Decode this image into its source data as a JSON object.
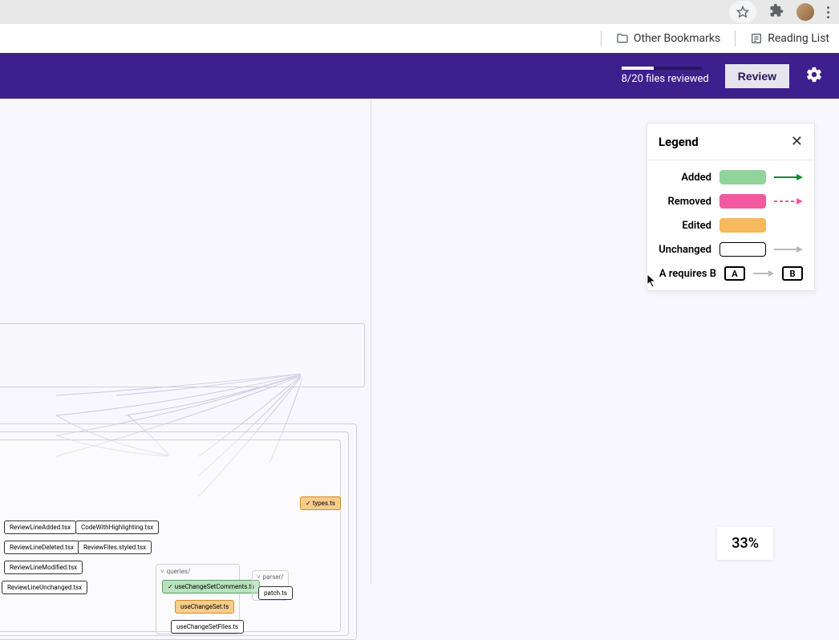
{
  "browser": {
    "otherBookmarks": "Other Bookmarks",
    "readingList": "Reading List"
  },
  "header": {
    "progress": {
      "current": 8,
      "total": 20,
      "label": "8/20 files reviewed",
      "percent": 40
    },
    "reviewButton": "Review"
  },
  "legend": {
    "title": "Legend",
    "rows": {
      "added": "Added",
      "removed": "Removed",
      "edited": "Edited",
      "unchanged": "Unchanged",
      "requires": "A requires B",
      "a": "A",
      "b": "B"
    },
    "colors": {
      "added": "#91d49b",
      "removed": "#f15a9e",
      "edited": "#f6b95c",
      "unchanged": "#ffffff",
      "arrow_added": "#0e8a33",
      "arrow_removed": "#f15a9e",
      "arrow_unchanged": "#b9b9c0"
    }
  },
  "graph": {
    "folders": {
      "queries": "queries/",
      "parser": "parser/"
    },
    "nodes": {
      "types": "types.ts",
      "reviewLineAdded": "ReviewLineAdded.tsx",
      "codeWithHighlighting": "CodeWithHighlighting.tsx",
      "reviewLineDeleted": "ReviewLineDeleted.tsx",
      "reviewFilesStyled": "ReviewFiles.styled.tsx",
      "reviewLineModified": "ReviewLineModified.tsx",
      "reviewLineUnchanged": "ReviewLineUnchanged.tsx",
      "useChangeSetComments": "useChangeSetComments.ts",
      "useChangeSet": "useChangeSet.ts",
      "useChangeSetFiles": "useChangeSetFiles.ts",
      "patch": "patch.ts"
    }
  },
  "zoom": {
    "label": "33%"
  }
}
